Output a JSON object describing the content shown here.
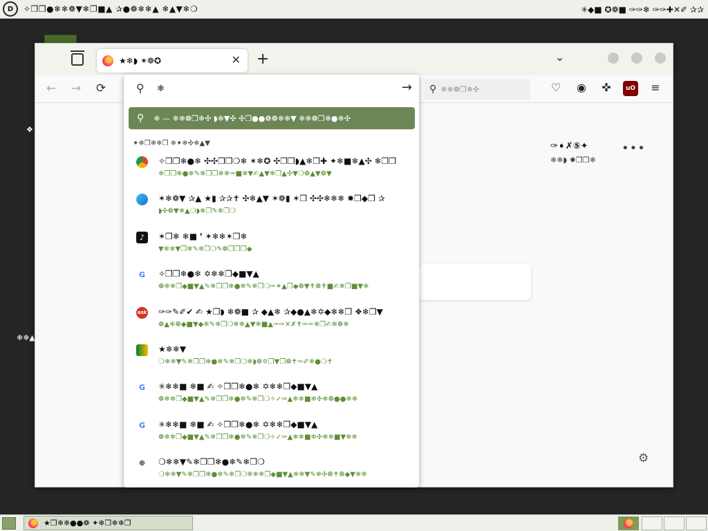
{
  "topbar": {
    "menu_text": "✧❒❒●❄❄❁▼❄❒■▲  ✰●❁❄❄▲  ❄▲▼❄❍",
    "tray_text": "✳◆■ ✪❁■ ✑✑❄ ✑✑✚✕✐ ✰✰"
  },
  "desktop": {
    "text1": "❖",
    "text2": "❄❄▲"
  },
  "browser": {
    "tab": {
      "title": "★❄◗ ✶❁✪",
      "close": "✕"
    },
    "new_tab": "+",
    "tab_list_chevron": "⌄",
    "nav": {
      "back": "←",
      "forward": "→",
      "reload": "⟳"
    },
    "search_placeholder": "❄❄❁❒❄✣",
    "urlbar": {
      "value": "❄",
      "go_icon": "→",
      "highlight_text": "❄ — ❄❄❁❒❄✣ ◗❄▼✣ ✣❒●●❁❁❄❄▼ ❄❄❁❒❄●❄✣",
      "section_heading": "✦❄❒❄❄❒ ❄✦❄✣❄▲▼",
      "results": [
        {
          "icon": "chrome",
          "title": "✧❒❒❄●❄ ✣✣❒❒❍❄ ✶❄✪ ✣❒❒◗▲❄❒✚ ✦❄■❄▲✣ ❄❒❒",
          "url": "❄❒❒❄●❄✎❄❒❒❄❄✑■❄▼✍▲▼❄❒▲✣▼❍❁▲▼❁▼"
        },
        {
          "icon": "edge",
          "title": "✶❄❁▼ ✰▲ ★▮ ✰✰✝ ✣❄▲▼ ✶❁▮ ✶❒ ✣✣❄❄❄ ✸❒◆❒ ✰",
          "url": "◗✣❁▼❄▲❍◗❄❒✎❄❒❍"
        },
        {
          "icon": "tiktok",
          "title": "✶❒❄ ❄■ ❜ ✶❄❄✶❒❄",
          "url": "▼❄❄▼❒❄✎❄❒❍✎❁❒❒❒◆"
        },
        {
          "icon": "google",
          "title": "✧❒❒❄●❄ ✡❄❄❒◆■▼▲",
          "url": "❁❄❄❒◆■▼▲✎❄❒❒❄●❄✎❄❒❍✑✶▲❒◆❁▼✝❁✝■✍❄❒■▼❄"
        },
        {
          "icon": "ask",
          "title": "✑✑✎✐✔ ✍ ★❒◗ ❄❁■ ✰ ◆▲❄ ✰◆●▲❄✡◆❄❄❒ ❖❄❒▼",
          "url": "❁▲❄❁◆■▼◆❄✎❄❒❍❄❄▲▼❄■▲✑✑✕✗✝✑✑❄❒✍❄❁❄"
        },
        {
          "icon": "gmeet",
          "title": "★❄❄▼",
          "url": "❍❄❄▼✎❄❒❒❄●❄✎❄❒❍❄◗❁✡❒▼❒❁✝✑✐❄●❍✝"
        },
        {
          "icon": "google",
          "title": "✳❄❄■ ❄■ ✍ ✧❒❒❄●❄ ✡❄❄❒◆■▼▲",
          "url": "❁❄❄❒◆■▼▲✎❄❒❒❄●❄✎❄❒❍✧✓✑▲❄❄■❄✣❄❁●●❄❄"
        },
        {
          "icon": "google",
          "title": "✳❄❄■ ❄■ ✍ ✧❒❒❄●❄ ✡❄❄❒◆■▼▲",
          "url": "❁❄❄❒◆■▼▲✎❄❒❒❄●❄✎❄❒❍✧✓✑▲❄❄■❄✣❄❄■▼❄❄"
        },
        {
          "icon": "globe",
          "title": "❍❄❄▼✎❄❒❒❄●❄✎❄❒❍",
          "url": "❍❄❄▼✎❄❒❒❄●❄✎❄❒❍❄❄❄❒◆■▼▲❄❄▼✎❄✣❁✝❁◆▼❄❄"
        }
      ]
    },
    "shortcut": {
      "label": "✑➧✗⑤✦",
      "sub": "❄❄◗ ✸❒❒❄"
    },
    "more_dots": "•••",
    "gear": "⚙"
  },
  "taskbar": {
    "task_label": "★❒❄❄●●❁ ✦❄❒❄❄❒"
  },
  "colors": {
    "accent": "#6d8656",
    "url_green": "#5e8f37",
    "desktop_bg": "#252525"
  }
}
